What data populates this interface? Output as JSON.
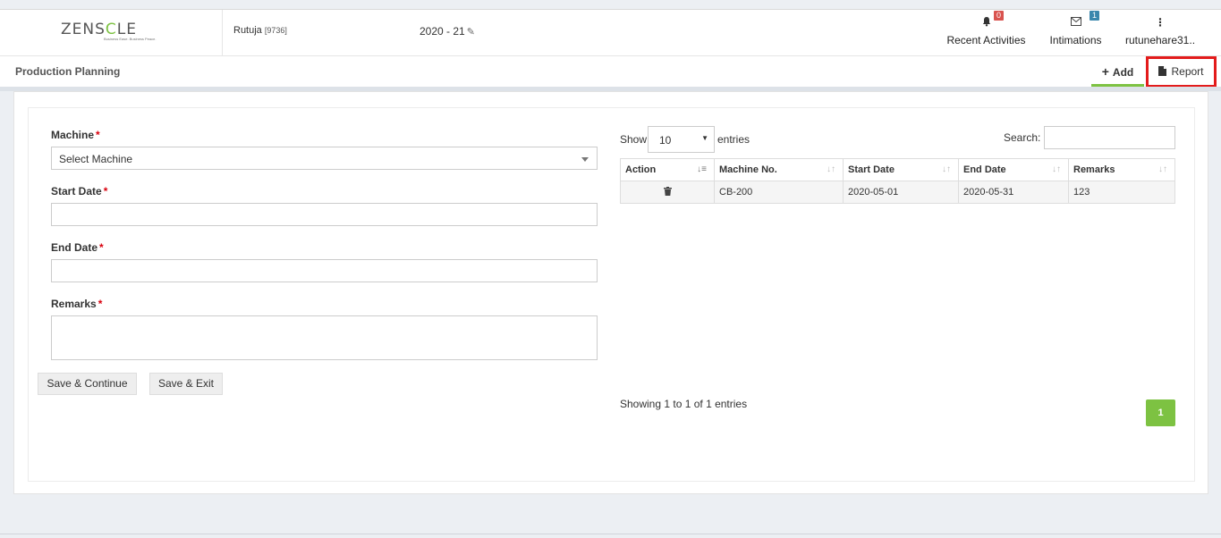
{
  "header": {
    "logo_left": "ZENS",
    "logo_mid": "C",
    "logo_right": "LE",
    "logo_tagline": "Business Ease. Business Peace.",
    "user_name": "Rutuja",
    "user_id": "[9736]",
    "financial_year": "2020 - 21",
    "recent_activities": {
      "label": "Recent Activities",
      "badge": "0",
      "icon": "bell-icon"
    },
    "intimations": {
      "label": "Intimations",
      "badge": "1",
      "icon": "envelope-icon"
    },
    "account": {
      "label": "rutunehare31..",
      "icon": "kebab-menu-icon"
    }
  },
  "subbar": {
    "page_title": "Production Planning",
    "add_label": "Add",
    "report_label": "Report"
  },
  "form": {
    "machine_label": "Machine",
    "machine_placeholder": "Select Machine",
    "start_date_label": "Start Date",
    "end_date_label": "End Date",
    "remarks_label": "Remarks",
    "required_mark": "*",
    "save_continue": "Save & Continue",
    "save_exit": "Save & Exit"
  },
  "table_controls": {
    "show_label": "Show",
    "page_length": "10",
    "entries_label": "entries",
    "search_label": "Search:"
  },
  "table": {
    "columns": [
      "Action",
      "Machine No.",
      "Start Date",
      "End Date",
      "Remarks"
    ],
    "rows": [
      {
        "action_icon": "trash-icon",
        "machine_no": "CB-200",
        "start_date": "2020-05-01",
        "end_date": "2020-05-31",
        "remarks": "123"
      }
    ]
  },
  "pagination": {
    "info": "Showing 1 to 1 of 1 entries",
    "current_page": "1"
  },
  "colors": {
    "accent_green": "#7dc242",
    "highlight_red": "#e31b1b",
    "badge_red": "#d9534f",
    "badge_blue": "#3a87ad"
  }
}
